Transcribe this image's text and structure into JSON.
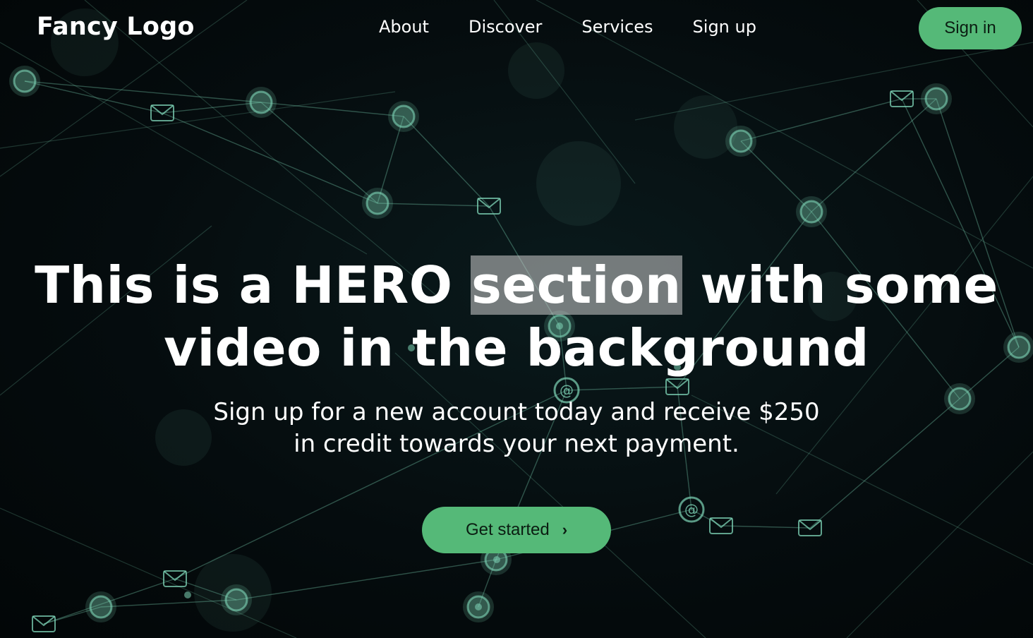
{
  "brand": {
    "logo_text": "Fancy Logo"
  },
  "nav": {
    "links": [
      "About",
      "Discover",
      "Services",
      "Sign up"
    ],
    "signin_label": "Sign in"
  },
  "hero": {
    "title_part1": "This is a HERO ",
    "title_highlight": "section",
    "title_part2": " with some",
    "title_line2": "video in the background",
    "subtitle_line1": "Sign up for a new account today and receive $250",
    "subtitle_line2": "in credit towards your next payment.",
    "cta_label": "Get started",
    "cta_icon": "chevron-right-icon"
  },
  "colors": {
    "accent": "#55b978",
    "background": "#050c0e",
    "network": "#7fd6b8",
    "text": "#ffffff"
  }
}
